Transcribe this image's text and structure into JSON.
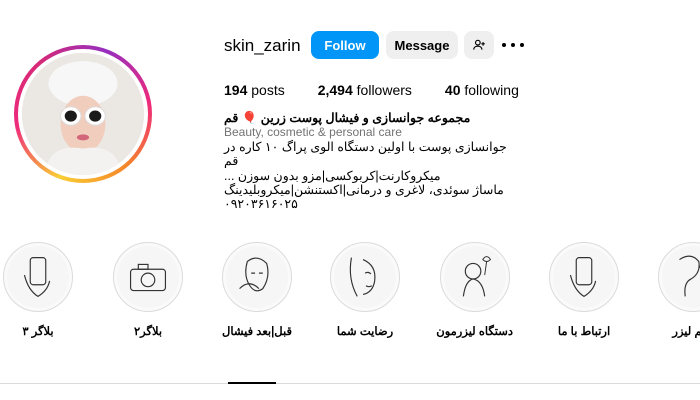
{
  "profile": {
    "username": "skin_zarin",
    "follow_label": "Follow",
    "message_label": "Message",
    "add_user_icon": "add-person-icon",
    "more_icon": "more-horizontal-icon"
  },
  "stats": {
    "posts_count": "194",
    "posts_label": "posts",
    "followers_count": "2,494",
    "followers_label": "followers",
    "following_count": "40",
    "following_label": "following"
  },
  "bio": {
    "name": "مجموعه جوانسازی و فیشال پوست زرین 🎈 قم",
    "category": "Beauty, cosmetic & personal care",
    "lines": [
      "جوانسازی پوست با اولین دستگاه الوی پراگ ۱۰ کاره در قم",
      "میکروکارنت|کربوکسی|مزو بدون سوزن ...",
      "ماساژ سوئدی، لاغری و درمانی|اکستنشن|میکروبلیدینگ",
      "۰۹۲۰۳۶۱۶۰۲۵"
    ]
  },
  "highlights": [
    {
      "label": "بلاگر ۳"
    },
    {
      "label": "بلاگر۲"
    },
    {
      "label": "قبل|بعد فیشال"
    },
    {
      "label": "رضایت شما"
    },
    {
      "label": "دستگاه لیزرمون"
    },
    {
      "label": "ارتباط با ما"
    },
    {
      "label": "مهم لیزر"
    }
  ],
  "colors": {
    "accent": "#0095f6",
    "badge": "#e6007e"
  }
}
